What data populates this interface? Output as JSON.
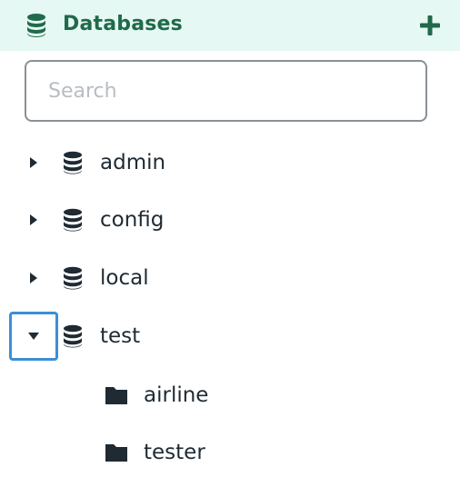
{
  "header": {
    "title": "Databases",
    "icon": "database-icon",
    "add_icon": "plus-icon",
    "accent_color": "#1f6a4a",
    "background_color": "#e6f8f3"
  },
  "search": {
    "placeholder": "Search",
    "value": ""
  },
  "databases": [
    {
      "label": "admin",
      "expanded": false,
      "icon": "database-icon",
      "toggle_icon": "caret-right-icon"
    },
    {
      "label": "config",
      "expanded": false,
      "icon": "database-icon",
      "toggle_icon": "caret-right-icon"
    },
    {
      "label": "local",
      "expanded": false,
      "icon": "database-icon",
      "toggle_icon": "caret-right-icon"
    },
    {
      "label": "test",
      "expanded": true,
      "focused": true,
      "icon": "database-icon",
      "toggle_icon": "caret-down-icon",
      "collections": [
        {
          "label": "airline",
          "icon": "folder-icon"
        },
        {
          "label": "tester",
          "icon": "folder-icon"
        }
      ]
    }
  ],
  "focus_color": "#3b8fd6"
}
